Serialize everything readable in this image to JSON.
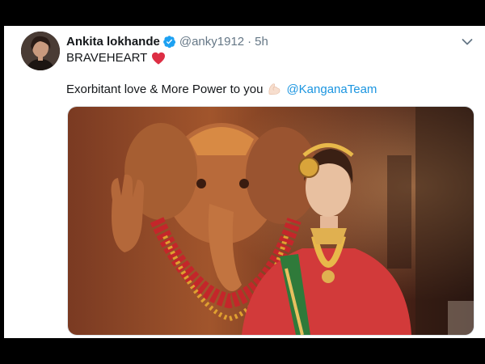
{
  "tweet": {
    "display_name": "Ankita lokhande",
    "verified": true,
    "handle": "@anky1912",
    "separator": "·",
    "time": "5h",
    "text_line1": "BRAVEHEART",
    "text_line2": "Exorbitant love & More Power to you",
    "mention": "@KanganaTeam"
  },
  "icons": {
    "verified": "verified-badge-icon",
    "caret": "chevron-down-icon",
    "heart": "red-heart-icon",
    "muscle": "flexed-biceps-icon"
  },
  "colors": {
    "link": "#1b95e0",
    "verified": "#1da1f2",
    "heart": "#e0245e",
    "text": "#14171a",
    "secondary": "#657786"
  }
}
